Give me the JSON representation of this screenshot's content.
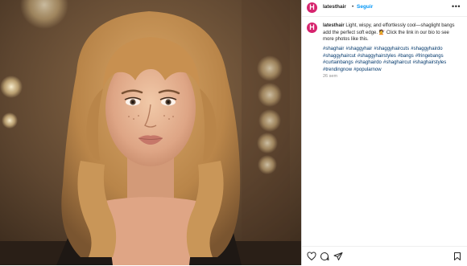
{
  "account": {
    "avatar_letter": "H",
    "username": "latesthair",
    "separator": "•",
    "follow_label": "Seguir",
    "more_icon": "more-icon"
  },
  "caption": {
    "username": "latesthair",
    "text": "Light, wispy, and effortlessly cool—shaglight bangs add the perfect soft edge. 💇 Click the link in our bio to see more photos like this.",
    "hashtags": "#shaghair #shaggyhair #shaggyhaircuts #shaggyhairdo #shaggyhaircut #shaggyhairstyles #bangs #fringebangs #curtainbangs #shaghairdo #shaghaircut #shaghairstyles #trendingnow #popularnow",
    "timestamp": "26 sem"
  },
  "actions": {
    "like_icon": "heart-icon",
    "comment_icon": "comment-icon",
    "share_icon": "share-icon",
    "save_icon": "bookmark-icon"
  },
  "colors": {
    "brand_avatar": "#d6246e",
    "follow_link": "#0095f6",
    "hashtag": "#00376b"
  }
}
